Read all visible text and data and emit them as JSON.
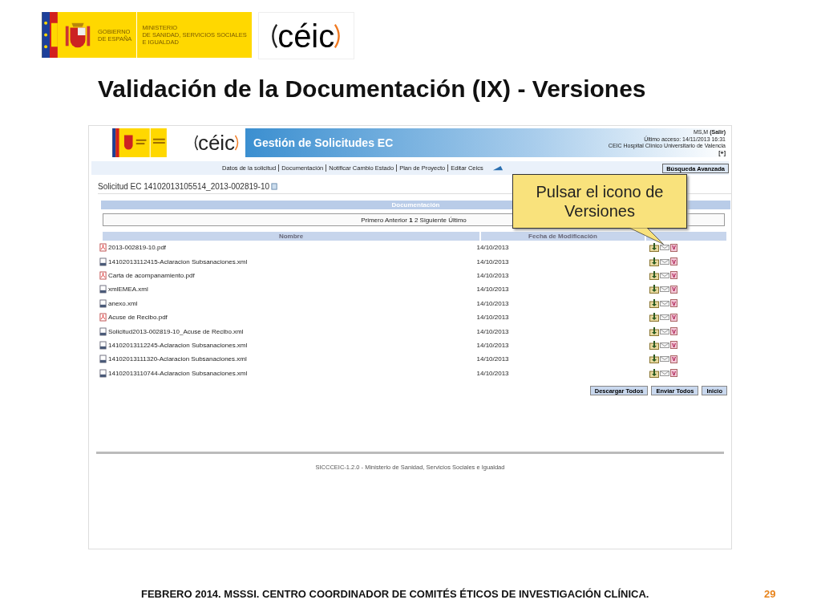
{
  "logos": {
    "government": [
      "GOBIERNO",
      "DE ESPAÑA"
    ],
    "ministry": [
      "MINISTERIO",
      "DE SANIDAD, SERVICIOS SOCIALES",
      "E IGUALDAD"
    ],
    "ceic": "céic"
  },
  "slide_title": "Validación de la Documentación (IX) - Versiones",
  "app": {
    "logo_text": "céic",
    "title": "Gestión de Solicitudes EC",
    "user": "MS,M",
    "logout": "(Salir)",
    "last_access": "Último acceso: 14/11/2013 16:31",
    "center": "CEIC Hospital Clínico Universitario de Valencia",
    "expand": "[+]",
    "nav": [
      "Datos de la solicitud",
      "Documentación",
      "Notificar Cambio Estado",
      "Plan de Proyecto",
      "Editar Ceics"
    ],
    "advanced_search": "Búsqueda Avanzada",
    "request_title": "Solicitud EC 14102013105514_2013-002819-10",
    "section_title": "Documentación",
    "pager": "Primero Anterior **1** 2 Siguiente Último",
    "columns": [
      "Nombre",
      "Fecha de Modificación"
    ],
    "rows": [
      {
        "kind": "pdf",
        "name": "2013-002819-10.pdf",
        "date": "14/10/2013",
        "version_mark": "V"
      },
      {
        "kind": "xml",
        "name": "14102013112415-Aclaracion Subsanaciones.xml",
        "date": "14/10/2013",
        "version_mark": "V"
      },
      {
        "kind": "pdf",
        "name": "Carta de acompanamiento.pdf",
        "date": "14/10/2013",
        "version_mark": "V"
      },
      {
        "kind": "xml",
        "name": "xmlEMEA.xml",
        "date": "14/10/2013",
        "version_mark": "V"
      },
      {
        "kind": "xml",
        "name": "anexo.xml",
        "date": "14/10/2013",
        "version_mark": "V"
      },
      {
        "kind": "pdf",
        "name": "Acuse de Recibo.pdf",
        "date": "14/10/2013",
        "version_mark": "V"
      },
      {
        "kind": "xml",
        "name": "Solicitud2013-002819-10_Acuse de Recibo.xml",
        "date": "14/10/2013",
        "version_mark": "V"
      },
      {
        "kind": "xml",
        "name": "14102013112245-Aclaracion Subsanaciones.xml",
        "date": "14/10/2013",
        "version_mark": "V"
      },
      {
        "kind": "xml",
        "name": "14102013111320-Aclaracion Subsanaciones.xml",
        "date": "14/10/2013",
        "version_mark": "V"
      },
      {
        "kind": "xml",
        "name": "14102013110744-Aclaracion Subsanaciones.xml",
        "date": "14/10/2013",
        "version_mark": "V"
      }
    ],
    "buttons": [
      "Descargar Todos",
      "Enviar Todos",
      "Inicio"
    ],
    "footer": "SICCCEIC-1.2.0 - Ministerio de Sanidad, Servicios Sociales e Igualdad"
  },
  "callout": "Pulsar el icono de Versiones",
  "footer": "FEBRERO 2014. MSSSI. CENTRO COORDINADOR DE COMITÉS ÉTICOS DE INVESTIGACIÓN CLÍNICA.",
  "page_number": "29"
}
